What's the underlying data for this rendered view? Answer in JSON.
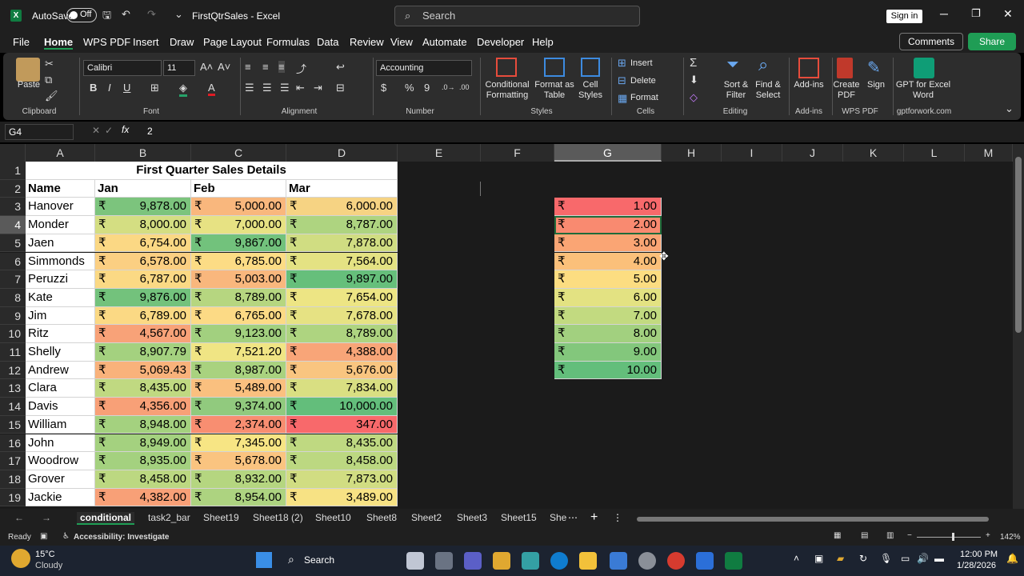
{
  "titlebar": {
    "autosave_label": "AutoSave",
    "autosave_state": "Off",
    "filename": "FirstQtrSales - Excel",
    "search_placeholder": "Search",
    "signin": "Sign in"
  },
  "menu": [
    "File",
    "Home",
    "WPS PDF",
    "Insert",
    "Draw",
    "Page Layout",
    "Formulas",
    "Data",
    "Review",
    "View",
    "Automate",
    "Developer",
    "Help"
  ],
  "menu_active": "Home",
  "comments": "Comments",
  "share": "Share",
  "ribbon": {
    "clipboard": {
      "paste": "Paste",
      "group": "Clipboard"
    },
    "font": {
      "name": "Calibri",
      "size": "11",
      "group": "Font"
    },
    "alignment": {
      "group": "Alignment"
    },
    "number": {
      "format": "Accounting",
      "group": "Number"
    },
    "styles": {
      "conditional": "Conditional Formatting",
      "format_table": "Format as Table",
      "cell_styles": "Cell Styles",
      "group": "Styles"
    },
    "cells": {
      "insert": "Insert",
      "delete": "Delete",
      "format": "Format",
      "group": "Cells"
    },
    "editing": {
      "sort": "Sort & Filter",
      "find": "Find & Select",
      "group": "Editing"
    },
    "addins": {
      "label": "Add-ins",
      "group": "Add-ins"
    },
    "wps": {
      "create": "Create PDF",
      "sign": "Sign",
      "group": "WPS PDF"
    },
    "gpt": {
      "label": "GPT for Excel Word",
      "group": "gptforwork.com"
    }
  },
  "formula_bar": {
    "name_box": "G4",
    "formula": "2",
    "fx": "fx"
  },
  "columns": [
    "A",
    "B",
    "C",
    "D",
    "E",
    "F",
    "G",
    "H",
    "I",
    "J",
    "K",
    "L",
    "M"
  ],
  "selected_column": "G",
  "selected_row": "4",
  "rows": [
    "1",
    "2",
    "3",
    "4",
    "5",
    "6",
    "7",
    "8",
    "9",
    "10",
    "11",
    "12",
    "13",
    "14",
    "15",
    "16",
    "17",
    "18",
    "19"
  ],
  "sheet": {
    "title": "First Quarter Sales Details",
    "headers": [
      "Name",
      "Jan",
      "Feb",
      "Mar"
    ],
    "currency": "₹",
    "data": [
      {
        "name": "Hanover",
        "jan": "9,878.00",
        "feb": "5,000.00",
        "mar": "6,000.00",
        "c": [
          "#7cc47d",
          "#f9b77d",
          "#f6d383"
        ]
      },
      {
        "name": "Monder",
        "jan": "8,000.00",
        "feb": "7,000.00",
        "mar": "8,787.00",
        "c": [
          "#d4de82",
          "#e7e283",
          "#aed480"
        ]
      },
      {
        "name": "Jaen",
        "jan": "6,754.00",
        "feb": "9,867.00",
        "mar": "7,878.00",
        "c": [
          "#fbd884",
          "#72c27c",
          "#d0dd82"
        ]
      },
      {
        "name": "Simmonds",
        "jan": "6,578.00",
        "feb": "6,785.00",
        "mar": "7,564.00",
        "c": [
          "#fbcf82",
          "#fcdc85",
          "#e4e283"
        ]
      },
      {
        "name": "Peruzzi",
        "jan": "6,787.00",
        "feb": "5,003.00",
        "mar": "9,897.00",
        "c": [
          "#fbd984",
          "#f9b77d",
          "#66bf7b"
        ]
      },
      {
        "name": "Kate",
        "jan": "9,876.00",
        "feb": "8,789.00",
        "mar": "7,654.00",
        "c": [
          "#73c27c",
          "#b6d680",
          "#ede584"
        ]
      },
      {
        "name": "Jim",
        "jan": "6,789.00",
        "feb": "6,765.00",
        "mar": "7,678.00",
        "c": [
          "#fbd984",
          "#fcda85",
          "#e6e283"
        ]
      },
      {
        "name": "Ritz",
        "jan": "4,567.00",
        "feb": "9,123.00",
        "mar": "8,789.00",
        "c": [
          "#f8a278",
          "#a2d07f",
          "#aed480"
        ]
      },
      {
        "name": "Shelly",
        "jan": "8,907.79",
        "feb": "7,521.20",
        "mar": "4,388.00",
        "c": [
          "#a4d17f",
          "#f0e584",
          "#f8a578"
        ]
      },
      {
        "name": "Andrew",
        "jan": "5,069.43",
        "feb": "8,987.00",
        "mar": "5,676.00",
        "c": [
          "#f9b27b",
          "#a9d27f",
          "#f9c580"
        ]
      },
      {
        "name": "Clara",
        "jan": "8,435.00",
        "feb": "5,489.00",
        "mar": "7,834.00",
        "c": [
          "#c0d981",
          "#fac07f",
          "#d9df82"
        ]
      },
      {
        "name": "Davis",
        "jan": "4,356.00",
        "feb": "9,374.00",
        "mar": "10,000.00",
        "c": [
          "#f8a077",
          "#91ca7e",
          "#63be7b"
        ]
      },
      {
        "name": "William",
        "jan": "8,948.00",
        "feb": "2,374.00",
        "mar": "347.00",
        "c": [
          "#a4d17f",
          "#f88e71",
          "#f8696b"
        ]
      },
      {
        "name": "John",
        "jan": "8,949.00",
        "feb": "7,345.00",
        "mar": "8,435.00",
        "c": [
          "#a4d17f",
          "#f7e584",
          "#bfd981"
        ]
      },
      {
        "name": "Woodrow",
        "jan": "8,935.00",
        "feb": "5,678.00",
        "mar": "8,458.00",
        "c": [
          "#a4d17f",
          "#fac480",
          "#bcd881"
        ]
      },
      {
        "name": "Grover",
        "jan": "8,458.00",
        "feb": "8,932.00",
        "mar": "7,873.00",
        "c": [
          "#bcd881",
          "#b5d680",
          "#d1dd82"
        ]
      },
      {
        "name": "Jackie",
        "jan": "4,382.00",
        "feb": "8,954.00",
        "mar": "3,489.00",
        "c": [
          "#f8a077",
          "#add380",
          "#f7e284"
        ]
      }
    ],
    "gcol": [
      {
        "v": "1.00",
        "c": "#f8696b"
      },
      {
        "v": "2.00",
        "c": "#f98a70"
      },
      {
        "v": "3.00",
        "c": "#faa574"
      },
      {
        "v": "4.00",
        "c": "#fbc07a"
      },
      {
        "v": "5.00",
        "c": "#fcdd81"
      },
      {
        "v": "6.00",
        "c": "#e3e282"
      },
      {
        "v": "7.00",
        "c": "#c2da80"
      },
      {
        "v": "8.00",
        "c": "#a2d07f"
      },
      {
        "v": "9.00",
        "c": "#83c77c"
      },
      {
        "v": "10.00",
        "c": "#63be7b"
      }
    ]
  },
  "tabs": [
    "conditional",
    "task2_bar",
    "Sheet19",
    "Sheet18 (2)",
    "Sheet10",
    "Sheet8",
    "Sheet2",
    "Sheet3",
    "Sheet15",
    "She"
  ],
  "active_tab": "conditional",
  "status": {
    "ready": "Ready",
    "accessibility": "Accessibility: Investigate",
    "zoom": "142%"
  },
  "taskbar": {
    "temp": "15°C",
    "weather": "Cloudy",
    "search": "Search",
    "time": "12:00 PM",
    "date": "1/28/2026"
  }
}
